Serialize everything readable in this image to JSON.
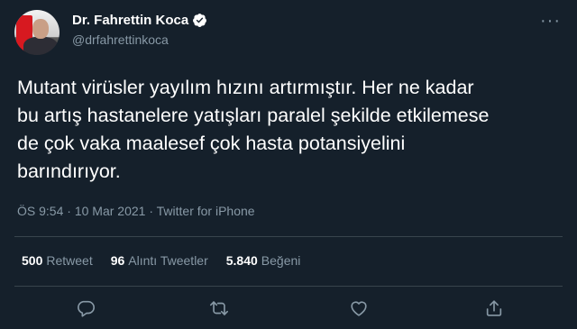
{
  "author": {
    "display_name": "Dr. Fahrettin Koca",
    "handle": "@drfahrettinkoca",
    "verified": true
  },
  "tweet": {
    "text": "Mutant virüsler yayılım hızını artırmıştır. Her ne kadar\nbu artış hastanelere yatışları paralel şekilde etkilemese\nde çok vaka maalesef çok hasta potansiyelini\nbarındırıyor.",
    "time": "ÖS 9:54",
    "separator1": " · ",
    "date": "10 Mar 2021",
    "separator2": " · ",
    "source": "Twitter for iPhone"
  },
  "stats": {
    "retweets_count": "500",
    "retweets_label": "Retweet",
    "quotes_count": "96",
    "quotes_label": "Alıntı Tweetler",
    "likes_count": "5.840",
    "likes_label": "Beğeni"
  },
  "icons": {
    "more": "more-icon",
    "reply": "reply-icon",
    "retweet": "retweet-icon",
    "like": "like-icon",
    "share": "share-icon",
    "verified": "verified-badge-icon"
  },
  "colors": {
    "background": "#15202b",
    "text": "#ffffff",
    "secondary": "#8899a6",
    "divider": "#38444d",
    "verified": "#ffffff"
  }
}
